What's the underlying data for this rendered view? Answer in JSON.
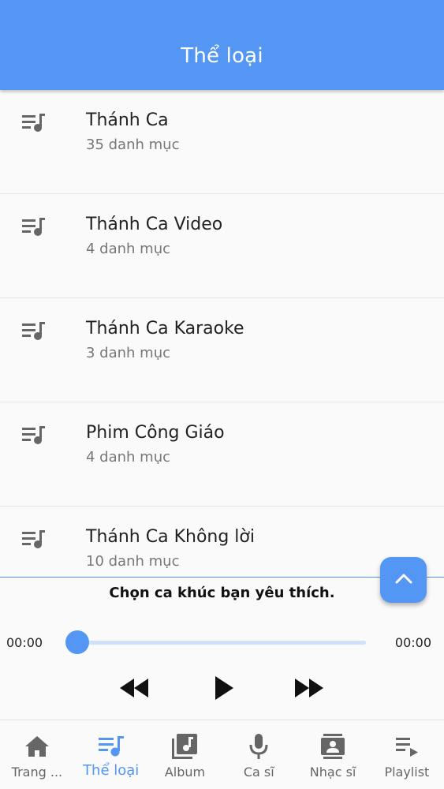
{
  "header": {
    "title": "Thể loại"
  },
  "categories": [
    {
      "title": "Thánh Ca",
      "count": "35 danh mục",
      "icon": "queue-music-icon"
    },
    {
      "title": "Thánh Ca Video",
      "count": "4 danh mục",
      "icon": "queue-music-icon"
    },
    {
      "title": "Thánh Ca Karaoke",
      "count": "3 danh mục",
      "icon": "queue-music-icon"
    },
    {
      "title": "Phim Công Giáo",
      "count": "4 danh mục",
      "icon": "queue-music-icon"
    },
    {
      "title": "Thánh Ca Không lời",
      "count": "10 danh mục",
      "icon": "queue-music-icon"
    }
  ],
  "player": {
    "now_playing": "Chọn ca khúc bạn yêu thích.",
    "current_time": "00:00",
    "total_time": "00:00",
    "progress": 0
  },
  "bottom_nav": [
    {
      "label": "Trang ...",
      "icon": "home-icon",
      "active": false
    },
    {
      "label": "Thể loại",
      "icon": "queue-music-icon",
      "active": true
    },
    {
      "label": "Album",
      "icon": "library-music-icon",
      "active": false
    },
    {
      "label": "Ca sĩ",
      "icon": "mic-icon",
      "active": false
    },
    {
      "label": "Nhạc sĩ",
      "icon": "contacts-icon",
      "active": false
    },
    {
      "label": "Playlist",
      "icon": "playlist-play-icon",
      "active": false
    }
  ],
  "colors": {
    "primary": "#5396f3",
    "icon_gray": "#666666",
    "text": "#222222",
    "subtext": "#777777"
  }
}
